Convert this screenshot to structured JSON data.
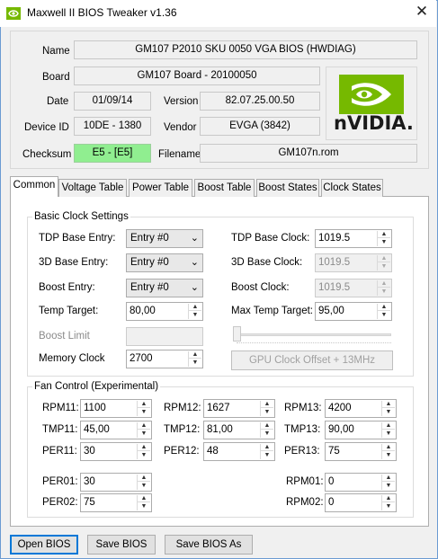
{
  "window": {
    "title": "Maxwell II BIOS Tweaker v1.36",
    "close_glyph": "✕"
  },
  "info": {
    "name_label": "Name",
    "name_value": "GM107 P2010 SKU 0050 VGA BIOS (HWDIAG)",
    "board_label": "Board",
    "board_value": "GM107 Board - 20100050",
    "date_label": "Date",
    "date_value": "01/09/14",
    "version_label": "Version",
    "version_value": "82.07.25.00.50",
    "device_label": "Device ID",
    "device_value": "10DE - 1380",
    "vendor_label": "Vendor",
    "vendor_value": "EVGA (3842)",
    "checksum_label": "Checksum",
    "checksum_value": "E5 - [E5]",
    "filename_label": "Filename",
    "filename_value": "GM107n.rom",
    "logo_text": "nVIDIA."
  },
  "colors": {
    "checksum_ok": "#90ee90",
    "nvidia_green": "#76b900"
  },
  "tabs": [
    "Common",
    "Voltage Table",
    "Power Table",
    "Boost Table",
    "Boost States",
    "Clock States"
  ],
  "basic": {
    "title": "Basic Clock Settings",
    "tdp_entry_label": "TDP Base Entry:",
    "tdp_entry_value": "Entry #0",
    "base3d_entry_label": "3D Base Entry:",
    "base3d_entry_value": "Entry #0",
    "boost_entry_label": "Boost Entry:",
    "boost_entry_value": "Entry #0",
    "temp_target_label": "Temp Target:",
    "temp_target_value": "80,00",
    "boost_limit_label": "Boost Limit",
    "memory_clock_label": "Memory Clock",
    "memory_clock_value": "2700",
    "tdp_clock_label": "TDP Base Clock:",
    "tdp_clock_value": "1019.5",
    "base3d_clock_label": "3D Base Clock:",
    "base3d_clock_value": "1019.5",
    "boost_clock_label": "Boost Clock:",
    "boost_clock_value": "1019.5",
    "max_temp_label": "Max Temp Target:",
    "max_temp_value": "95,00",
    "gpu_offset_label": "GPU Clock Offset + 13MHz",
    "slider_level": 0
  },
  "fan": {
    "title": "Fan Control (Experimental)",
    "rpm11_label": "RPM11:",
    "rpm11_value": "1100",
    "rpm12_label": "RPM12:",
    "rpm12_value": "1627",
    "rpm13_label": "RPM13:",
    "rpm13_value": "4200",
    "tmp11_label": "TMP11:",
    "tmp11_value": "45,00",
    "tmp12_label": "TMP12:",
    "tmp12_value": "81,00",
    "tmp13_label": "TMP13:",
    "tmp13_value": "90,00",
    "per11_label": "PER11:",
    "per11_value": "30",
    "per12_label": "PER12:",
    "per12_value": "48",
    "per13_label": "PER13:",
    "per13_value": "75",
    "per01_label": "PER01:",
    "per01_value": "30",
    "per02_label": "PER02:",
    "per02_value": "75",
    "rpm01_label": "RPM01:",
    "rpm01_value": "0",
    "rpm02_label": "RPM02:",
    "rpm02_value": "0"
  },
  "buttons": {
    "open": "Open BIOS",
    "save": "Save BIOS",
    "save_as": "Save BIOS As"
  },
  "glyphs": {
    "dropdown": "⌄",
    "up": "▲",
    "down": "▼"
  }
}
